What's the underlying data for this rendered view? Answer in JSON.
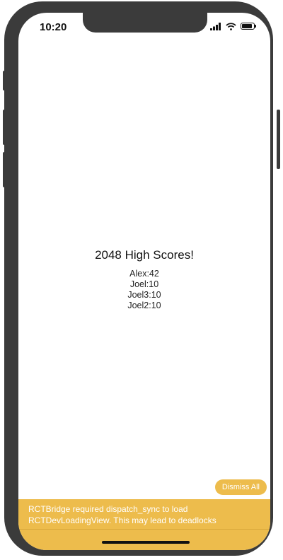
{
  "status_bar": {
    "time": "10:20",
    "battery_level": 0.85
  },
  "main": {
    "title": "2048 High Scores!",
    "scores": [
      "Alex:42",
      "Joel:10",
      "Joel3:10",
      "Joel2:10"
    ]
  },
  "warning": {
    "dismiss_label": "Dismiss All",
    "message": "RCTBridge required dispatch_sync to load RCTDevLoadingView. This may lead to deadlocks",
    "color": "#edbc4c"
  },
  "icons": [
    "signal-icon",
    "wifi-icon",
    "battery-icon"
  ]
}
